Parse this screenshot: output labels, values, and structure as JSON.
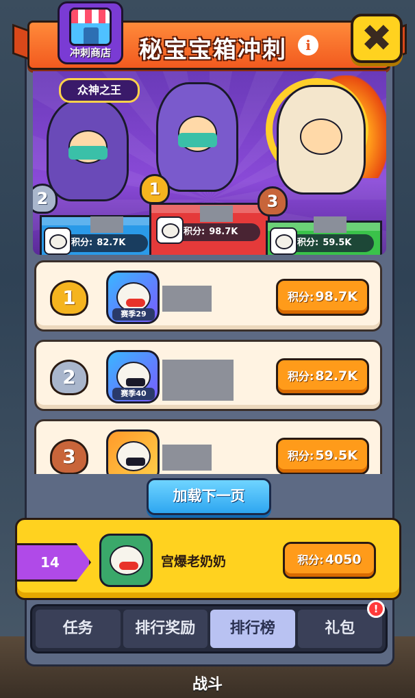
{
  "header": {
    "title": "秘宝宝箱冲刺",
    "shop_label": "冲刺商店",
    "info_icon": "i",
    "close_icon": "✖"
  },
  "podium": {
    "crown_title": "众神之王",
    "first": {
      "rank": "1",
      "score_label": "积分:",
      "score": "98.7K",
      "season": "赛季29"
    },
    "second": {
      "rank": "2",
      "score_label": "积分:",
      "score": "82.7K",
      "season": "赛季40"
    },
    "third": {
      "rank": "3",
      "score_label": "积分:",
      "score": "59.5K"
    }
  },
  "ranking": [
    {
      "rank": "1",
      "season": "赛季29",
      "score_label": "积分:",
      "score": "98.7K"
    },
    {
      "rank": "2",
      "season": "赛季40",
      "score_label": "积分:",
      "score": "82.7K"
    },
    {
      "rank": "3",
      "score_label": "积分:",
      "score": "59.5K"
    }
  ],
  "load_more_label": "加载下一页",
  "me": {
    "rank": "14",
    "name": "宫爆老奶奶",
    "score_label": "积分:",
    "score": "4050"
  },
  "tabs": [
    {
      "label": "任务"
    },
    {
      "label": "排行奖励"
    },
    {
      "label": "排行榜"
    },
    {
      "label": "礼包",
      "badge": "!"
    }
  ],
  "background": {
    "bottom_label": "战斗"
  },
  "colors": {
    "accent_orange": "#ff9b1a",
    "gold": "#ffd21f",
    "purple": "#b04ae8",
    "blue_button": "#2ea6f0",
    "active_tab": "#b9c2f2"
  }
}
